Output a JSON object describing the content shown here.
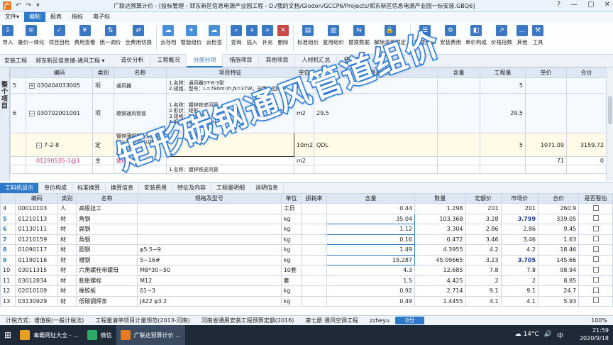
{
  "titlebar": {
    "logo": "广",
    "title": "广联达预算计价 - [投标管理 - 郑东新区信息电源产业园工程 - D:/我的文档/Glodon/GCCP6/Projects/郑东新区信息电源产业园一标安装.GBQ6]",
    "qa": [
      "↶",
      "↷",
      "▾"
    ],
    "controls": [
      "?",
      "—",
      "▢",
      "✕"
    ]
  },
  "menu": {
    "items": [
      "文件▾",
      "编制",
      "报表",
      "指标",
      "电子标"
    ],
    "active": 1
  },
  "ribbon": [
    {
      "label": "导入",
      "color": "#3b78c4",
      "icon": "⇩"
    },
    {
      "label": "量价一体化",
      "color": "#3b78c4",
      "icon": "≡"
    },
    {
      "label": "项目自检",
      "color": "#3b78c4",
      "icon": "✓"
    },
    {
      "label": "费用查看",
      "color": "#3b78c4",
      "icon": "¥"
    },
    {
      "label": "统一调价",
      "color": "#3b78c4",
      "icon": "⇅"
    },
    {
      "label": "全费用切换",
      "color": "#3b78c4",
      "icon": "⇄"
    },
    {
      "label": "云存档",
      "color": "#4a90d9",
      "icon": "☁"
    },
    {
      "label": "智能组价",
      "color": "#4a90d9",
      "icon": "✦"
    },
    {
      "label": "云检查",
      "color": "#4a90d9",
      "icon": "☁"
    },
    {
      "label": "查询",
      "color": "#3b78c4",
      "icon": "⌕"
    },
    {
      "label": "插入",
      "color": "#3b78c4",
      "icon": "+"
    },
    {
      "label": "补充",
      "color": "#3b78c4",
      "icon": "+"
    },
    {
      "label": "删除",
      "color": "#c84848",
      "icon": "✕"
    },
    {
      "label": "标准组价",
      "color": "#3b78c4",
      "icon": "▤"
    },
    {
      "label": "复用组价",
      "color": "#3b78c4",
      "icon": "▥"
    },
    {
      "label": "替换数据",
      "color": "#3b78c4",
      "icon": "⇆"
    },
    {
      "label": "解除清单锁定",
      "color": "#3b78c4",
      "icon": "🔒"
    },
    {
      "label": "整理清单",
      "color": "#3b78c4",
      "icon": "☰"
    },
    {
      "label": "安装费用",
      "color": "#3b78c4",
      "icon": "⚙"
    },
    {
      "label": "单价构成",
      "color": "#3b78c4",
      "icon": "◧"
    },
    {
      "label": "价格指数",
      "color": "#3b78c4",
      "icon": "↗"
    },
    {
      "label": "其他",
      "color": "#3b78c4",
      "icon": "…"
    },
    {
      "label": "工具",
      "color": "#3b78c4",
      "icon": "⚒"
    }
  ],
  "nav": {
    "crumbs": [
      "安装工程",
      "郑东新区信息储-通风工程 ▾"
    ],
    "tabs": [
      "造价分析",
      "工程概况",
      "分部分项",
      "措施项目",
      "其他项目",
      "人材机汇总",
      "费用汇总"
    ],
    "active_tab": 2
  },
  "sidebar": {
    "label": "整个项目"
  },
  "top_table": {
    "headers": [
      "",
      "编码",
      "类别",
      "名称",
      "项目特征",
      "单位",
      "工程量表达式",
      "含量",
      "工程量",
      "单价",
      "合价"
    ],
    "rows": [
      {
        "no": "5",
        "toggle": "+",
        "code": "030404033005",
        "type": "项",
        "name": "通风器",
        "feature": "1.名称：通风器ST-8-3型\n2.规格、型号：L=780m³/h,N=37W，自带止回阀",
        "unit": "台",
        "expr": "5",
        "content": "",
        "qty": "5",
        "price": "",
        "total": ""
      },
      {
        "no": "6",
        "toggle": "−",
        "code": "030702001001",
        "type": "项",
        "name": "碳钢通风管道",
        "feature": "1.名称：镀锌铁皮风管\n2.形状：矩形\n3.规格：500*320\n4.板材厚度：0.5mm",
        "unit": "m2",
        "expr": "29.5",
        "content": "",
        "qty": "29.5",
        "price": "",
        "total": ""
      },
      {
        "no": "",
        "toggle": "−",
        "code": "7-2-8",
        "type": "定",
        "name": "镀锌薄钢板矩形风管(δ=1.2mm以内咬口)长边长≤1000mm",
        "feature": "",
        "unit": "10m2",
        "expr": "QDL",
        "content": "",
        "qty": "5",
        "price": "1071.09",
        "total": "3159.72"
      },
      {
        "no": "",
        "toggle": "",
        "code": "01290535-1@1",
        "type": "主",
        "name": "镀锌钢板",
        "feature": "",
        "unit": "m2",
        "expr": "",
        "content": "",
        "qty": "",
        "price": "71",
        "total": "0"
      },
      {
        "no": "",
        "toggle": "",
        "code": "",
        "type": "",
        "name": "",
        "feature": "1.名称：镀锌铁皮风管",
        "unit": "",
        "expr": "",
        "content": "",
        "qty": "",
        "price": "",
        "total": ""
      }
    ]
  },
  "bottom_tabs": {
    "items": [
      "工料机显示",
      "单价构成",
      "标准换算",
      "换算信息",
      "安装费用",
      "特征及内容",
      "工程量明细",
      "说明信息"
    ],
    "active": 0
  },
  "bottom_table": {
    "headers": [
      "",
      "编码",
      "类别",
      "名称",
      "规格及型号",
      "单位",
      "损耗率",
      "含量",
      "数量",
      "定额价",
      "市场价",
      "合价",
      "是否暂估"
    ],
    "rows": [
      {
        "no": "4",
        "code": "00010103",
        "type": "人",
        "name": "高级技工",
        "spec": "",
        "unit": "工日",
        "loss": "",
        "content": "0.44",
        "qty": "1.298",
        "quota": "201",
        "market": "201",
        "total": "260.9",
        "market_bold": false
      },
      {
        "no": "5",
        "code": "01210113",
        "type": "材",
        "name": "角钢",
        "spec": "",
        "unit": "kg",
        "loss": "",
        "content": "35.04",
        "qty": "103.368",
        "quota": "3.28",
        "market": "3.799",
        "total": "339.05",
        "market_bold": true
      },
      {
        "no": "6",
        "code": "01130111",
        "type": "材",
        "name": "扁钢",
        "spec": "",
        "unit": "kg",
        "loss": "",
        "content": "1.12",
        "qty": "3.304",
        "quota": "2.86",
        "market": "2.86",
        "total": "9.45",
        "market_bold": false
      },
      {
        "no": "7",
        "code": "01210159",
        "type": "材",
        "name": "角钢",
        "spec": "",
        "unit": "kg",
        "loss": "",
        "content": "0.16",
        "qty": "0.472",
        "quota": "3.46",
        "market": "3.46",
        "total": "1.63",
        "market_bold": false
      },
      {
        "no": "8",
        "code": "01090117",
        "type": "材",
        "name": "圆钢",
        "spec": "φ5.5~9",
        "unit": "kg",
        "loss": "",
        "content": "1.49",
        "qty": "4.3955",
        "quota": "4.2",
        "market": "4.2",
        "total": "18.46",
        "market_bold": false
      },
      {
        "no": "9",
        "code": "01190116",
        "type": "材",
        "name": "槽钢",
        "spec": "5~16#",
        "unit": "kg",
        "loss": "",
        "content": "15.287",
        "qty": "45.09665",
        "quota": "3.23",
        "market": "3.705",
        "total": "145.66",
        "market_bold": true
      },
      {
        "no": "10",
        "code": "03011315",
        "type": "材",
        "name": "六角螺栓带螺母",
        "spec": "M8*30~50",
        "unit": "10套",
        "loss": "",
        "content": "4.3",
        "qty": "12.685",
        "quota": "7.8",
        "market": "7.8",
        "total": "98.94",
        "market_bold": false
      },
      {
        "no": "11",
        "code": "03012834",
        "type": "材",
        "name": "膨胀螺栓",
        "spec": "M12",
        "unit": "套",
        "loss": "",
        "content": "1.5",
        "qty": "4.425",
        "quota": "2",
        "market": "2",
        "total": "8.85",
        "market_bold": false
      },
      {
        "no": "12",
        "code": "02010109",
        "type": "材",
        "name": "橡胶板",
        "spec": "δ1~3",
        "unit": "kg",
        "loss": "",
        "content": "0.92",
        "qty": "2.714",
        "quota": "9.1",
        "market": "9.1",
        "total": "24.7",
        "market_bold": false
      },
      {
        "no": "13",
        "code": "03130929",
        "type": "材",
        "name": "低碳钢焊条",
        "spec": "J422 φ3.2",
        "unit": "kg",
        "loss": "",
        "content": "0.49",
        "qty": "1.4455",
        "quota": "4.1",
        "market": "4.1",
        "total": "5.93",
        "market_bold": false
      }
    ]
  },
  "overlay": {
    "text": "矩形碳钢通风管道组价"
  },
  "status": {
    "items": [
      "计税方式：增值税(一般计税法)",
      "工程量清单项目计量规范(2013-河南)",
      "河南省通用安装工程预算定额(2016)",
      "第七册 通风空调工程",
      "zzheyu"
    ],
    "score": "0分",
    "zoom": "100%"
  },
  "taskbar": {
    "items": [
      {
        "label": "毒霸网址大全 - ...",
        "color": "#e8a020"
      },
      {
        "label": "微信",
        "color": "#2aae67"
      },
      {
        "label": "广联达预算计价 ...",
        "color": "#e87a1e"
      }
    ],
    "weather": "14°C",
    "time": "21:59",
    "date": "2020/9/18",
    "ime": "中"
  }
}
